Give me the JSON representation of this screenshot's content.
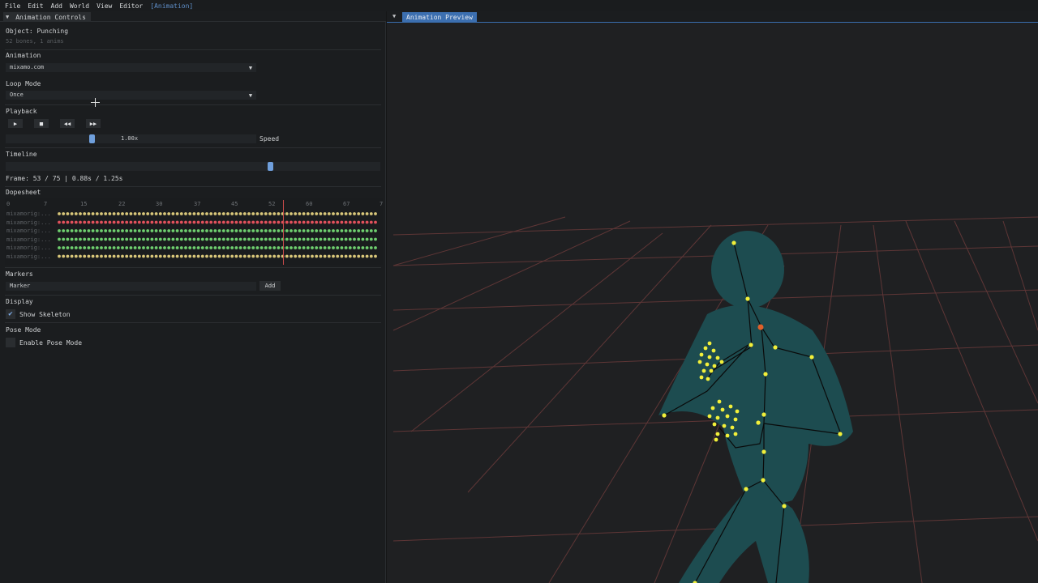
{
  "menu": {
    "items": [
      "File",
      "Edit",
      "Add",
      "World",
      "View",
      "Editor",
      "[Animation]"
    ]
  },
  "left_panel": {
    "tab_title": "Animation Controls",
    "object_label": "Object: Punching",
    "object_info": "52 bones, 1 anims",
    "animation": {
      "label": "Animation",
      "value": "mixamo.com"
    },
    "loop_mode": {
      "label": "Loop Mode",
      "value": "Once"
    },
    "playback": {
      "label": "Playback",
      "buttons": [
        "play",
        "stop",
        "rewind",
        "fast-forward"
      ],
      "speed_value": "1.00x",
      "speed_label": "Speed",
      "speed_fraction": 0.34
    },
    "timeline": {
      "label": "Timeline",
      "position_fraction": 0.71,
      "frame_info": "Frame: 53 / 75  |  0.88s / 1.25s"
    },
    "dopesheet": {
      "label": "Dopesheet",
      "ticks": [
        "0",
        "7",
        "15",
        "22",
        "30",
        "37",
        "45",
        "52",
        "60",
        "67",
        "7"
      ],
      "tracks": [
        {
          "name": "mixamorig:...",
          "color": "#d9c77a"
        },
        {
          "name": "mixamorig:...",
          "color": "#e2515c"
        },
        {
          "name": "mixamorig:...",
          "color": "#6fcf6f"
        },
        {
          "name": "mixamorig:...",
          "color": "#6fcf6f"
        },
        {
          "name": "mixamorig:...",
          "color": "#6fcf6f"
        },
        {
          "name": "mixamorig:...",
          "color": "#d9c77a"
        }
      ],
      "playhead_frame": 53
    },
    "markers": {
      "label": "Markers",
      "input_value": "Marker",
      "add_label": "Add"
    },
    "display": {
      "label": "Display",
      "show_skeleton_label": "Show Skeleton",
      "show_skeleton_checked": true
    },
    "pose_mode": {
      "label": "Pose Mode",
      "enable_label": "Enable Pose Mode",
      "enabled": false
    }
  },
  "viewport": {
    "tab_title": "Animation Preview"
  },
  "colors": {
    "accent": "#3c6fb0",
    "slider_grab": "#6f9fdc",
    "grid": "#7a3d3d",
    "mesh": "#1f4f52",
    "joint": "#f2f03a",
    "selected_joint": "#e0602a"
  }
}
